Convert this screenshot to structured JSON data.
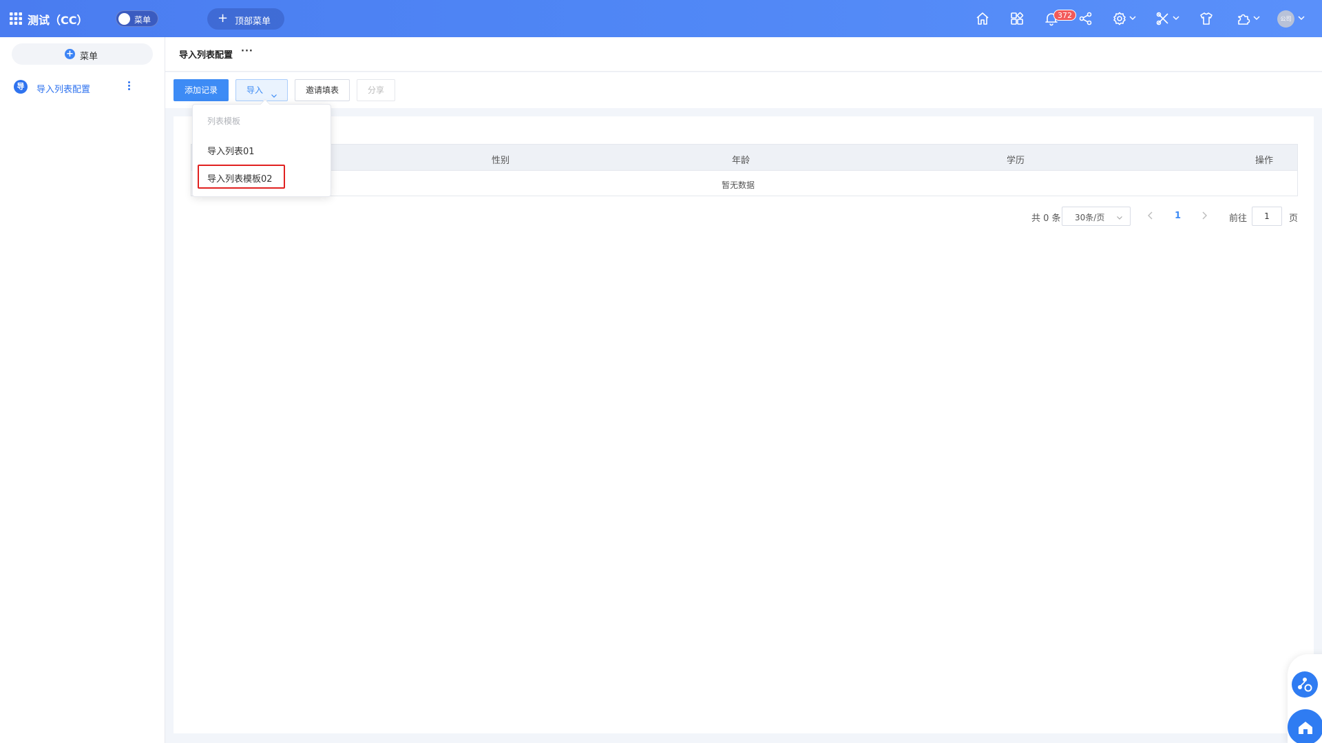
{
  "topbar": {
    "app_title": "测试（CC）",
    "menu_toggle_label": "菜单",
    "top_menu_label": "顶部菜单",
    "notification_count": "372",
    "avatar_text": "公司"
  },
  "sidebar": {
    "add_label": "菜单",
    "items": [
      {
        "icon_text": "导",
        "label": "导入列表配置"
      }
    ]
  },
  "page": {
    "title": "导入列表配置",
    "more": "···"
  },
  "toolbar": {
    "add_record": "添加记录",
    "import": "导入",
    "invite": "邀请填表",
    "share": "分享"
  },
  "import_dropdown": {
    "header": "列表模板",
    "items": [
      "导入列表01",
      "导入列表模板02"
    ],
    "highlighted_item": "导入列表模板02"
  },
  "table": {
    "columns": [
      "性别",
      "年龄",
      "学历",
      "操作"
    ],
    "rows": [],
    "empty_text": "暂无数据"
  },
  "pagination": {
    "total": "共 0 条",
    "page_size": "30条/页",
    "current_page": "1",
    "goto_label": "前往",
    "goto_value": "1",
    "page_suffix": "页"
  },
  "colors": {
    "topbar_start": "#4a7cf0",
    "topbar_end": "#5a90fa",
    "primary": "#3d8bf5",
    "badge": "#f25a5a",
    "highlight_box": "#e0201f"
  },
  "icons": [
    "grid-icon",
    "home-icon",
    "apps-icon",
    "bell-icon",
    "share-icon",
    "gear-icon",
    "tools-icon",
    "shirt-icon",
    "puzzle-icon",
    "chevron-down-icon",
    "chevron-left-icon",
    "chevron-right-icon"
  ]
}
